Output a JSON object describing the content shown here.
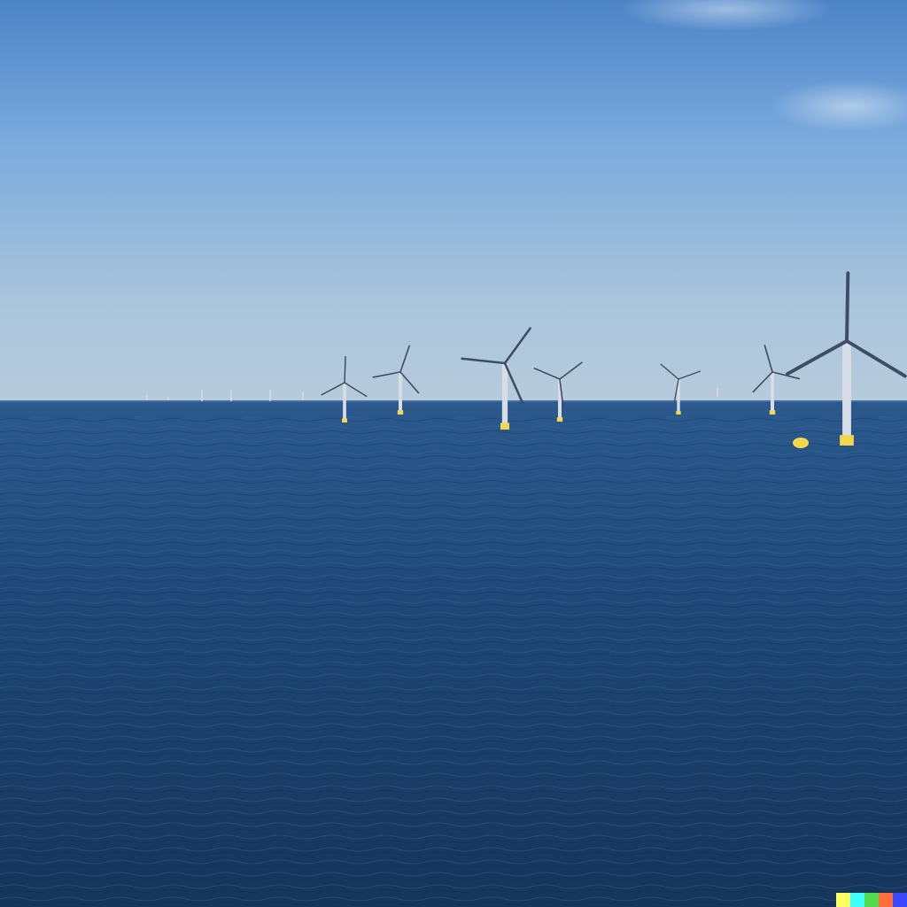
{
  "scene": {
    "subject": "offshore-wind-farm",
    "sky": {
      "colors": [
        "#4d84c7",
        "#7aaadd",
        "#a9c4dc",
        "#b7cbdb"
      ]
    },
    "sea": {
      "colors": [
        "#2c5a8e",
        "#234e80",
        "#1c416d",
        "#16355a"
      ]
    },
    "turbine_color": "#d6dde6",
    "buoy_color": "#f2d84a"
  },
  "watermark": {
    "colors": [
      "#ffff66",
      "#42ffff",
      "#51da4c",
      "#ff6e3c",
      "#3c46ff"
    ]
  }
}
